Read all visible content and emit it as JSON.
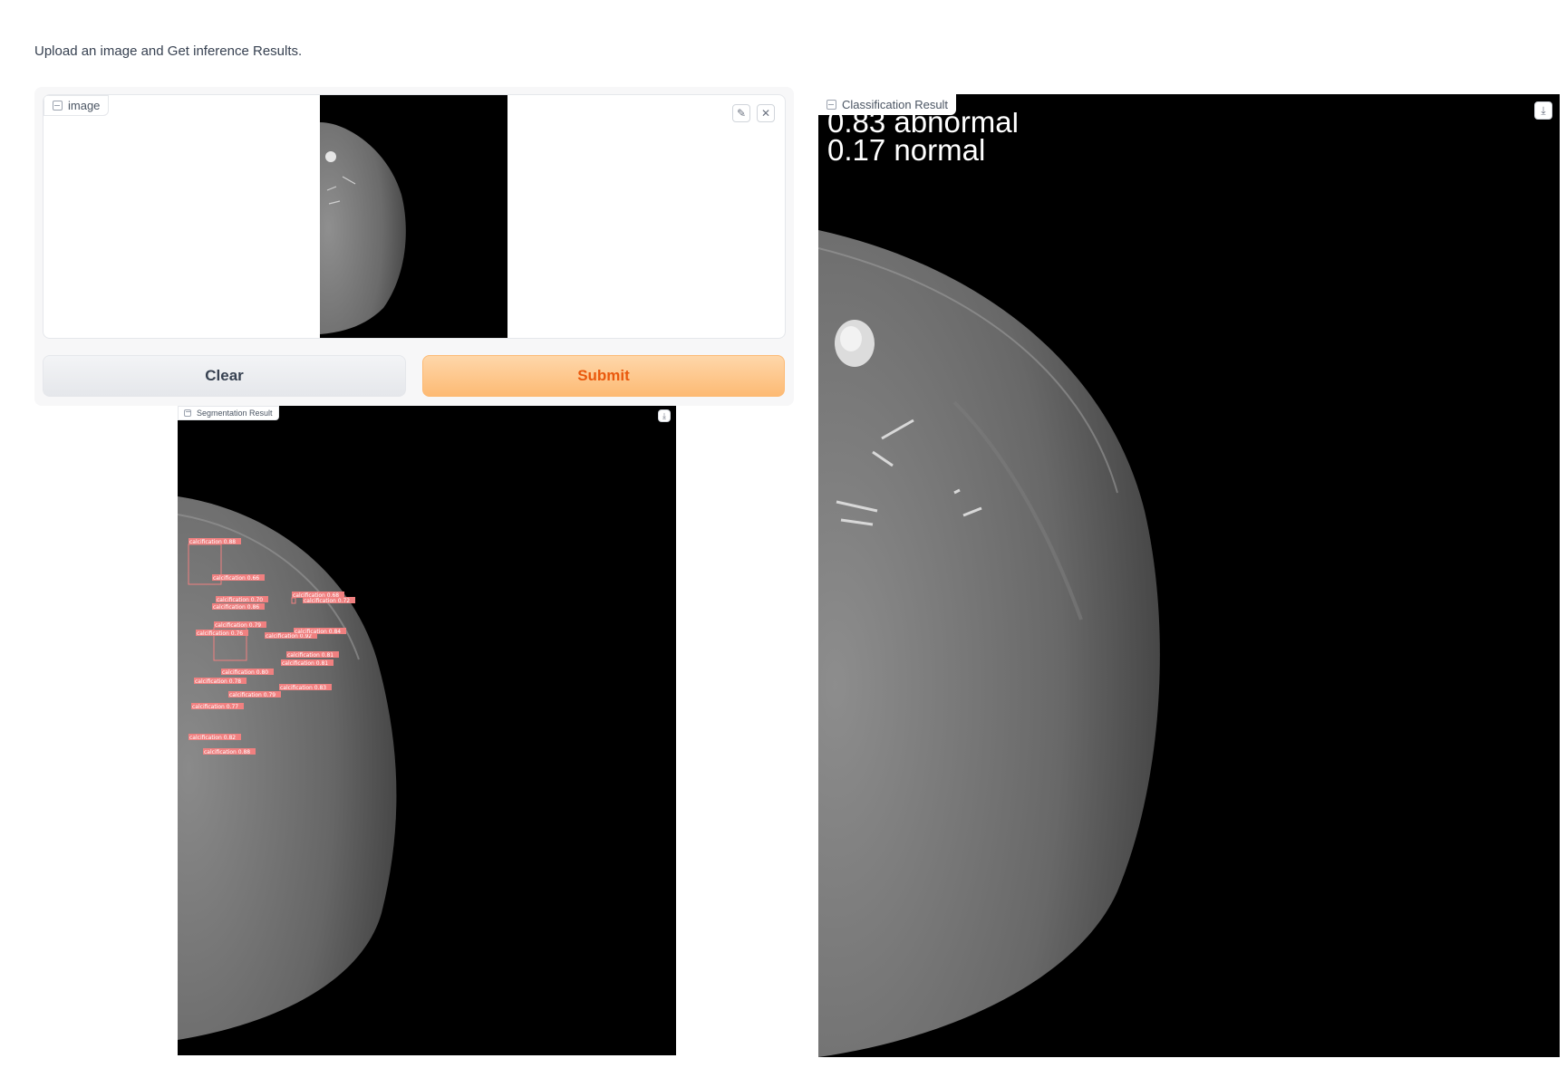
{
  "description": "Upload an image and Get inference Results.",
  "input": {
    "label": "image",
    "label_icon": "image-icon",
    "edit_icon": "pencil-icon",
    "close_icon": "close-icon"
  },
  "buttons": {
    "clear": "Clear",
    "submit": "Submit"
  },
  "segmentation": {
    "label": "Segmentation Result",
    "download_icon": "download-icon",
    "detections": [
      {
        "label": "calcification",
        "score": "0.88"
      },
      {
        "label": "calcification",
        "score": "0.66"
      },
      {
        "label": "calcification",
        "score": "0.70"
      },
      {
        "label": "calcification",
        "score": "0.86"
      },
      {
        "label": "calcification",
        "score": "0.68"
      },
      {
        "label": "calcification",
        "score": "0.72"
      },
      {
        "label": "calcification",
        "score": "0.79"
      },
      {
        "label": "calcification",
        "score": "0.92"
      },
      {
        "label": "calcification",
        "score": "0.84"
      },
      {
        "label": "calcification",
        "score": "0.81"
      },
      {
        "label": "calcification",
        "score": "0.81"
      },
      {
        "label": "calcification",
        "score": "0.76"
      },
      {
        "label": "calcification",
        "score": "0.80"
      },
      {
        "label": "calcification",
        "score": "0.78"
      },
      {
        "label": "calcification",
        "score": "0.83"
      },
      {
        "label": "calcification",
        "score": "0.79"
      },
      {
        "label": "calcification",
        "score": "0.77"
      },
      {
        "label": "calcification",
        "score": "0.82"
      },
      {
        "label": "calcification",
        "score": "0.88"
      }
    ]
  },
  "classification": {
    "label": "Classification Result",
    "download_icon": "download-icon",
    "results": [
      {
        "score": "0.83",
        "label": "abnormal"
      },
      {
        "score": "0.17",
        "label": "normal"
      }
    ]
  },
  "colors": {
    "submit_text": "#ea580c",
    "submit_bg": "#fdba74",
    "detection_box": "#f08080"
  }
}
